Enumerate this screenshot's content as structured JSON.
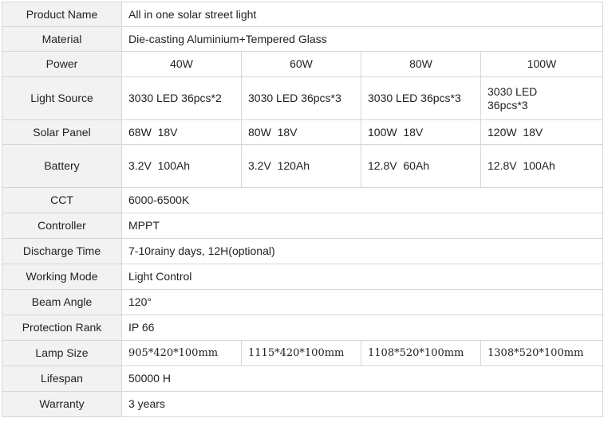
{
  "rows": {
    "product_name": {
      "label": "Product Name",
      "value": "All in one solar street light"
    },
    "material": {
      "label": "Material",
      "value": "Die-casting Aluminium+Tempered Glass"
    },
    "power": {
      "label": "Power",
      "values": [
        "40W",
        "60W",
        "80W",
        "100W"
      ]
    },
    "light_source": {
      "label": "Light Source",
      "values": [
        "3030 LED 36pcs*2",
        "3030 LED 36pcs*3",
        "3030 LED 36pcs*3",
        "3030 LED 36pcs*3"
      ]
    },
    "solar_panel": {
      "label": "Solar Panel",
      "values": [
        "68W  18V",
        "80W  18V",
        "100W  18V",
        "120W  18V"
      ]
    },
    "battery": {
      "label": "Battery",
      "values": [
        "3.2V  100Ah",
        "3.2V  120Ah",
        "12.8V  60Ah",
        "12.8V  100Ah"
      ]
    },
    "cct": {
      "label": "CCT",
      "value": "6000-6500K"
    },
    "controller": {
      "label": "Controller",
      "value": "MPPT"
    },
    "discharge_time": {
      "label": "Discharge Time",
      "value": "7-10rainy days, 12H(optional)"
    },
    "working_mode": {
      "label": "Working Mode",
      "value": "Light Control"
    },
    "beam_angle": {
      "label": "Beam Angle",
      "value": "120°"
    },
    "protection_rank": {
      "label": "Protection Rank",
      "value": "IP 66"
    },
    "lamp_size": {
      "label": "Lamp Size",
      "values": [
        "905*420*100mm",
        "1115*420*100mm",
        "1108*520*100mm",
        "1308*520*100mm"
      ]
    },
    "lifespan": {
      "label": "Lifespan",
      "value": "50000 H"
    },
    "warranty": {
      "label": "Warranty",
      "value": "3 years"
    }
  }
}
